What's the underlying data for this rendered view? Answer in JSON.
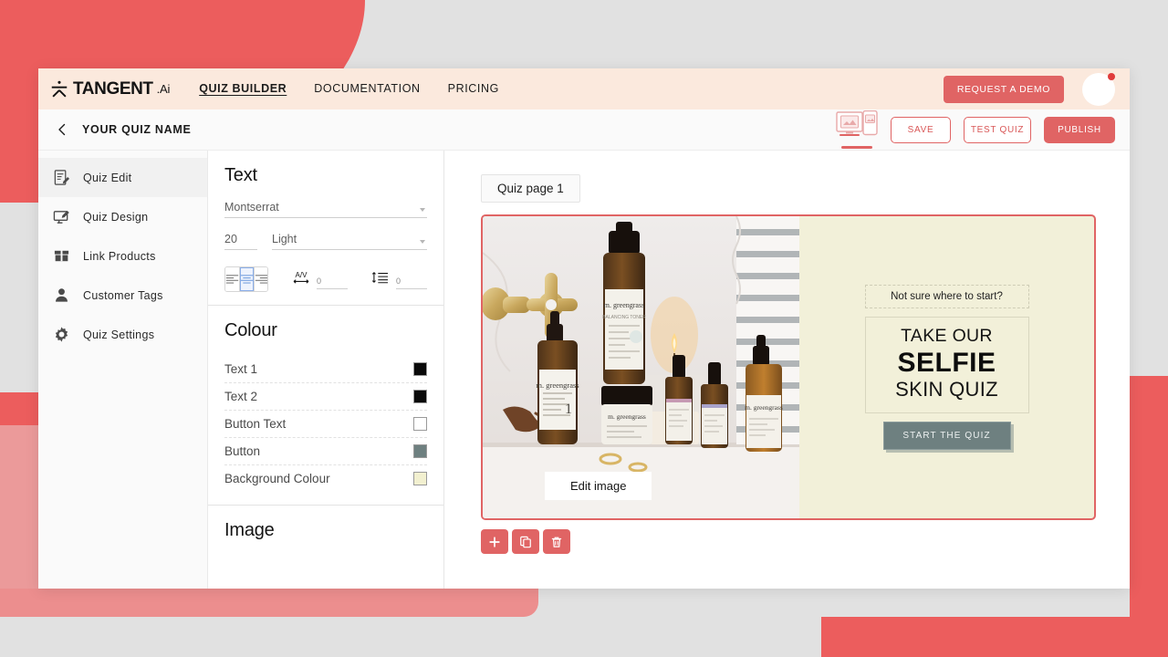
{
  "brand": {
    "name": "TANGENT",
    "suffix": ".Ai",
    "accent": "#e06464",
    "nav_bg": "#fbe9dd"
  },
  "topnav": {
    "links": [
      {
        "label": "QUIZ BUILDER",
        "active": true
      },
      {
        "label": "DOCUMENTATION",
        "active": false
      },
      {
        "label": "PRICING",
        "active": false
      }
    ],
    "demo_button": "REQUEST A DEMO"
  },
  "subheader": {
    "back_icon": "chevron-left-icon",
    "quiz_name": "YOUR QUIZ NAME",
    "preview_icon": "desktop-mobile-preview-icon",
    "buttons": [
      {
        "label": "SAVE",
        "style": "outline"
      },
      {
        "label": "TEST QUIZ",
        "style": "outline"
      },
      {
        "label": "PUBLISH",
        "style": "filled"
      }
    ]
  },
  "sidebar": {
    "items": [
      {
        "label": "Quiz  Edit",
        "icon": "edit-note-icon",
        "active": true
      },
      {
        "label": "Quiz  Design",
        "icon": "design-monitor-icon",
        "active": false
      },
      {
        "label": "Link Products",
        "icon": "products-box-icon",
        "active": false
      },
      {
        "label": "Customer Tags",
        "icon": "person-icon",
        "active": false
      },
      {
        "label": "Quiz  Settings",
        "icon": "gear-icon",
        "active": false
      }
    ]
  },
  "text_panel": {
    "title": "Text",
    "font_family": "Montserrat",
    "font_size": "20",
    "font_weight": "Light",
    "alignment": "center",
    "letter_spacing_label": "A/V",
    "letter_spacing_value": "0",
    "line_height_value": "0"
  },
  "colour_panel": {
    "title": "Colour",
    "rows": [
      {
        "label": "Text 1",
        "value": "#0a0a0a"
      },
      {
        "label": "Text 2",
        "value": "#0a0a0a"
      },
      {
        "label": "Button Text",
        "value": "#ffffff"
      },
      {
        "label": "Button",
        "value": "#6e8080"
      },
      {
        "label": "Background Colour",
        "value": "#f2f0d0"
      }
    ]
  },
  "image_panel": {
    "title": "Image"
  },
  "canvas": {
    "page_tab": "Quiz page 1",
    "edit_image_label": "Edit image",
    "quiz": {
      "subheading": "Not sure where to start?",
      "headline_line1": "TAKE OUR",
      "headline_line2": "SELFIE",
      "headline_line3": "SKIN QUIZ",
      "cta_label": "START THE QUIZ",
      "background": "#f2f0d9",
      "button_colour": "#6e8080"
    },
    "actions": [
      {
        "name": "add-block-button",
        "icon": "plus-icon"
      },
      {
        "name": "duplicate-block-button",
        "icon": "copy-icon"
      },
      {
        "name": "delete-block-button",
        "icon": "trash-icon"
      }
    ]
  }
}
